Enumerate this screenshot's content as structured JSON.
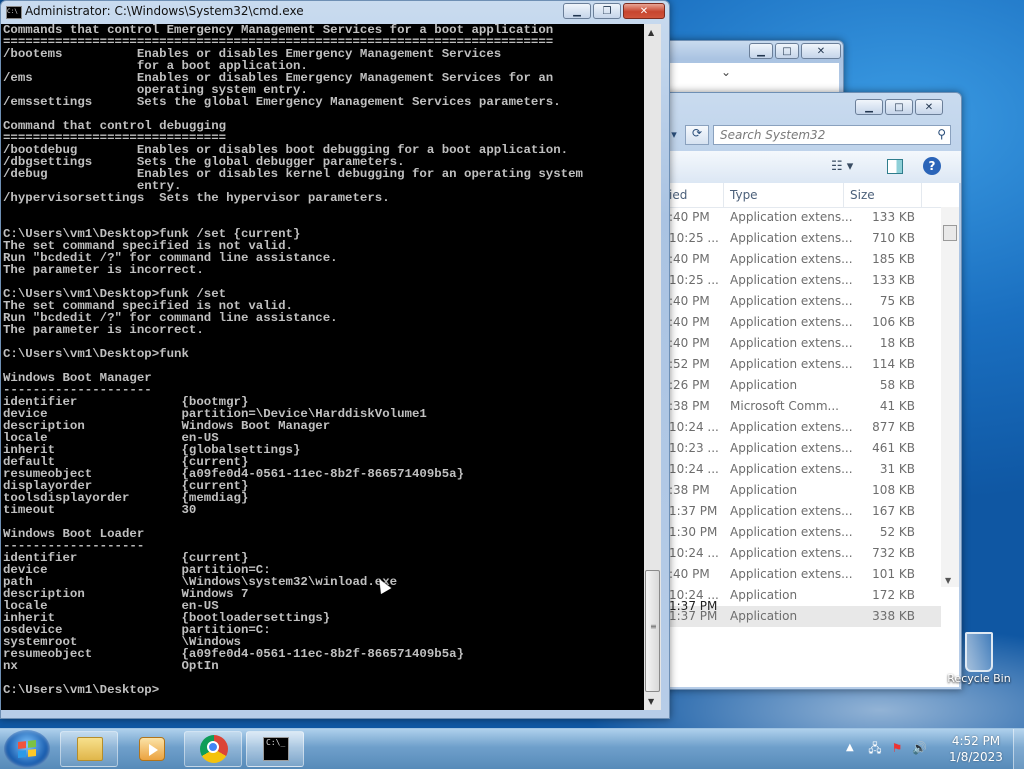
{
  "cmd_window": {
    "title": "Administrator: C:\\Windows\\System32\\cmd.exe",
    "icon_label": "C:\\",
    "console_lines": [
      "Commands that control Emergency Management Services for a boot application",
      "==========================================================================",
      "/bootems          Enables or disables Emergency Management Services",
      "                  for a boot application.",
      "/ems              Enables or disables Emergency Management Services for an",
      "                  operating system entry.",
      "/emssettings      Sets the global Emergency Management Services parameters.",
      "",
      "Command that control debugging",
      "==============================",
      "/bootdebug        Enables or disables boot debugging for a boot application.",
      "/dbgsettings      Sets the global debugger parameters.",
      "/debug            Enables or disables kernel debugging for an operating system",
      "                  entry.",
      "/hypervisorsettings  Sets the hypervisor parameters.",
      "",
      "",
      "C:\\Users\\vm1\\Desktop>funk /set {current}",
      "The set command specified is not valid.",
      "Run \"bcdedit /?\" for command line assistance.",
      "The parameter is incorrect.",
      "",
      "C:\\Users\\vm1\\Desktop>funk /set",
      "The set command specified is not valid.",
      "Run \"bcdedit /?\" for command line assistance.",
      "The parameter is incorrect.",
      "",
      "C:\\Users\\vm1\\Desktop>funk",
      "",
      "Windows Boot Manager",
      "--------------------",
      "identifier              {bootmgr}",
      "device                  partition=\\Device\\HarddiskVolume1",
      "description             Windows Boot Manager",
      "locale                  en-US",
      "inherit                 {globalsettings}",
      "default                 {current}",
      "resumeobject            {a09fe0d4-0561-11ec-8b2f-866571409b5a}",
      "displayorder            {current}",
      "toolsdisplayorder       {memdiag}",
      "timeout                 30",
      "",
      "Windows Boot Loader",
      "-------------------",
      "identifier              {current}",
      "device                  partition=C:",
      "path                    \\Windows\\system32\\winload.exe",
      "description             Windows 7",
      "locale                  en-US",
      "inherit                 {bootloadersettings}",
      "osdevice                partition=C:",
      "systemroot              \\Windows",
      "resumeobject            {a09fe0d4-0561-11ec-8b2f-866571409b5a}",
      "nx                      OptIn",
      "",
      "C:\\Users\\vm1\\Desktop>"
    ]
  },
  "explorer": {
    "search_placeholder": "Search System32",
    "columns": {
      "date": "ied",
      "type": "Type",
      "size": "Size"
    },
    "rows": [
      {
        "date": ":40 PM",
        "type": "Application extens...",
        "size": "133 KB"
      },
      {
        "date": "10:25 ...",
        "type": "Application extens...",
        "size": "710 KB"
      },
      {
        "date": ":40 PM",
        "type": "Application extens...",
        "size": "185 KB"
      },
      {
        "date": "10:25 ...",
        "type": "Application extens...",
        "size": "133 KB"
      },
      {
        "date": ":40 PM",
        "type": "Application extens...",
        "size": "75 KB"
      },
      {
        "date": ":40 PM",
        "type": "Application extens...",
        "size": "106 KB"
      },
      {
        "date": ":40 PM",
        "type": "Application extens...",
        "size": "18 KB"
      },
      {
        "date": ":52 PM",
        "type": "Application extens...",
        "size": "114 KB"
      },
      {
        "date": ":26 PM",
        "type": "Application",
        "size": "58 KB"
      },
      {
        "date": ":38 PM",
        "type": "Microsoft Comm...",
        "size": "41 KB"
      },
      {
        "date": "10:24 ...",
        "type": "Application extens...",
        "size": "877 KB"
      },
      {
        "date": "10:23 ...",
        "type": "Application extens...",
        "size": "461 KB"
      },
      {
        "date": "10:24 ...",
        "type": "Application extens...",
        "size": "31 KB"
      },
      {
        "date": ":38 PM",
        "type": "Application",
        "size": "108 KB"
      },
      {
        "date": "1:37 PM",
        "type": "Application extens...",
        "size": "167 KB"
      },
      {
        "date": "1:30 PM",
        "type": "Application extens...",
        "size": "52 KB"
      },
      {
        "date": "10:24 ...",
        "type": "Application extens...",
        "size": "732 KB"
      },
      {
        "date": ":40 PM",
        "type": "Application extens...",
        "size": "101 KB"
      },
      {
        "date": "10:24 ...",
        "type": "Application",
        "size": "172 KB"
      },
      {
        "date": "1:37 PM",
        "type": "Application",
        "size": "338 KB"
      }
    ],
    "details_date": "1:37 PM"
  },
  "desktop": {
    "recycle_bin_label": "Recycle Bin"
  },
  "taskbar": {
    "time": "4:52 PM",
    "date": "1/8/2023",
    "cmd_icon_label": "C:\\_"
  }
}
